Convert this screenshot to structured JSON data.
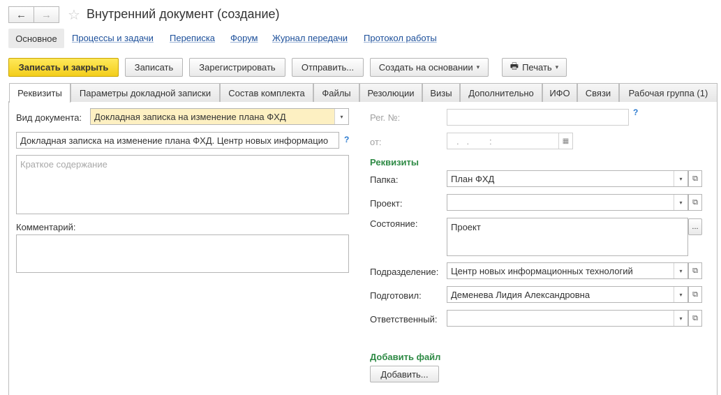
{
  "window": {
    "title": "Внутренний документ (создание)",
    "back_icon": "←",
    "forward_icon": "→",
    "star_icon": "☆"
  },
  "nav_links": {
    "active": "Основное",
    "items": [
      "Процессы и задачи",
      "Переписка",
      "Форум",
      "Журнал передачи",
      "Протокол работы"
    ]
  },
  "toolbar": {
    "save_close": "Записать и закрыть",
    "save": "Записать",
    "register": "Зарегистрировать",
    "send": "Отправить...",
    "create_based": "Создать на основании",
    "print": "Печать",
    "caret": "▾",
    "print_icon": "🖶"
  },
  "tabs": [
    "Реквизиты",
    "Параметры докладной записки",
    "Состав комплекта",
    "Файлы",
    "Резолюции",
    "Визы",
    "Дополнительно",
    "ИФО",
    "Связи",
    "Рабочая группа (1)"
  ],
  "left": {
    "doc_type_label": "Вид документа:",
    "doc_type_value": "Докладная записка на изменение плана ФХД",
    "title_value": "Докладная записка на изменение плана ФХД. Центр новых информацио",
    "summary_placeholder": "Краткое содержание",
    "comment_label": "Комментарий:",
    "qmark": "?"
  },
  "right": {
    "reg_no_label": "Рег. №:",
    "reg_no_value": "",
    "date_label": "от:",
    "date_value": ".   .        :",
    "qmark": "?",
    "section_title": "Реквизиты",
    "folder_label": "Папка:",
    "folder_value": "План ФХД",
    "project_label": "Проект:",
    "project_value": "",
    "state_label": "Состояние:",
    "state_value": "Проект",
    "dept_label": "Подразделение:",
    "dept_value": "Центр новых информационных технологий",
    "prepared_label": "Подготовил:",
    "prepared_value": "Деменева Лидия Александровна",
    "responsible_label": "Ответственный:",
    "responsible_value": "",
    "add_file_title": "Добавить файл",
    "add_button": "Добавить...",
    "dropdown_glyph": "▾",
    "open_glyph": "⧉",
    "dots_glyph": "...",
    "calendar_glyph": "▦"
  }
}
